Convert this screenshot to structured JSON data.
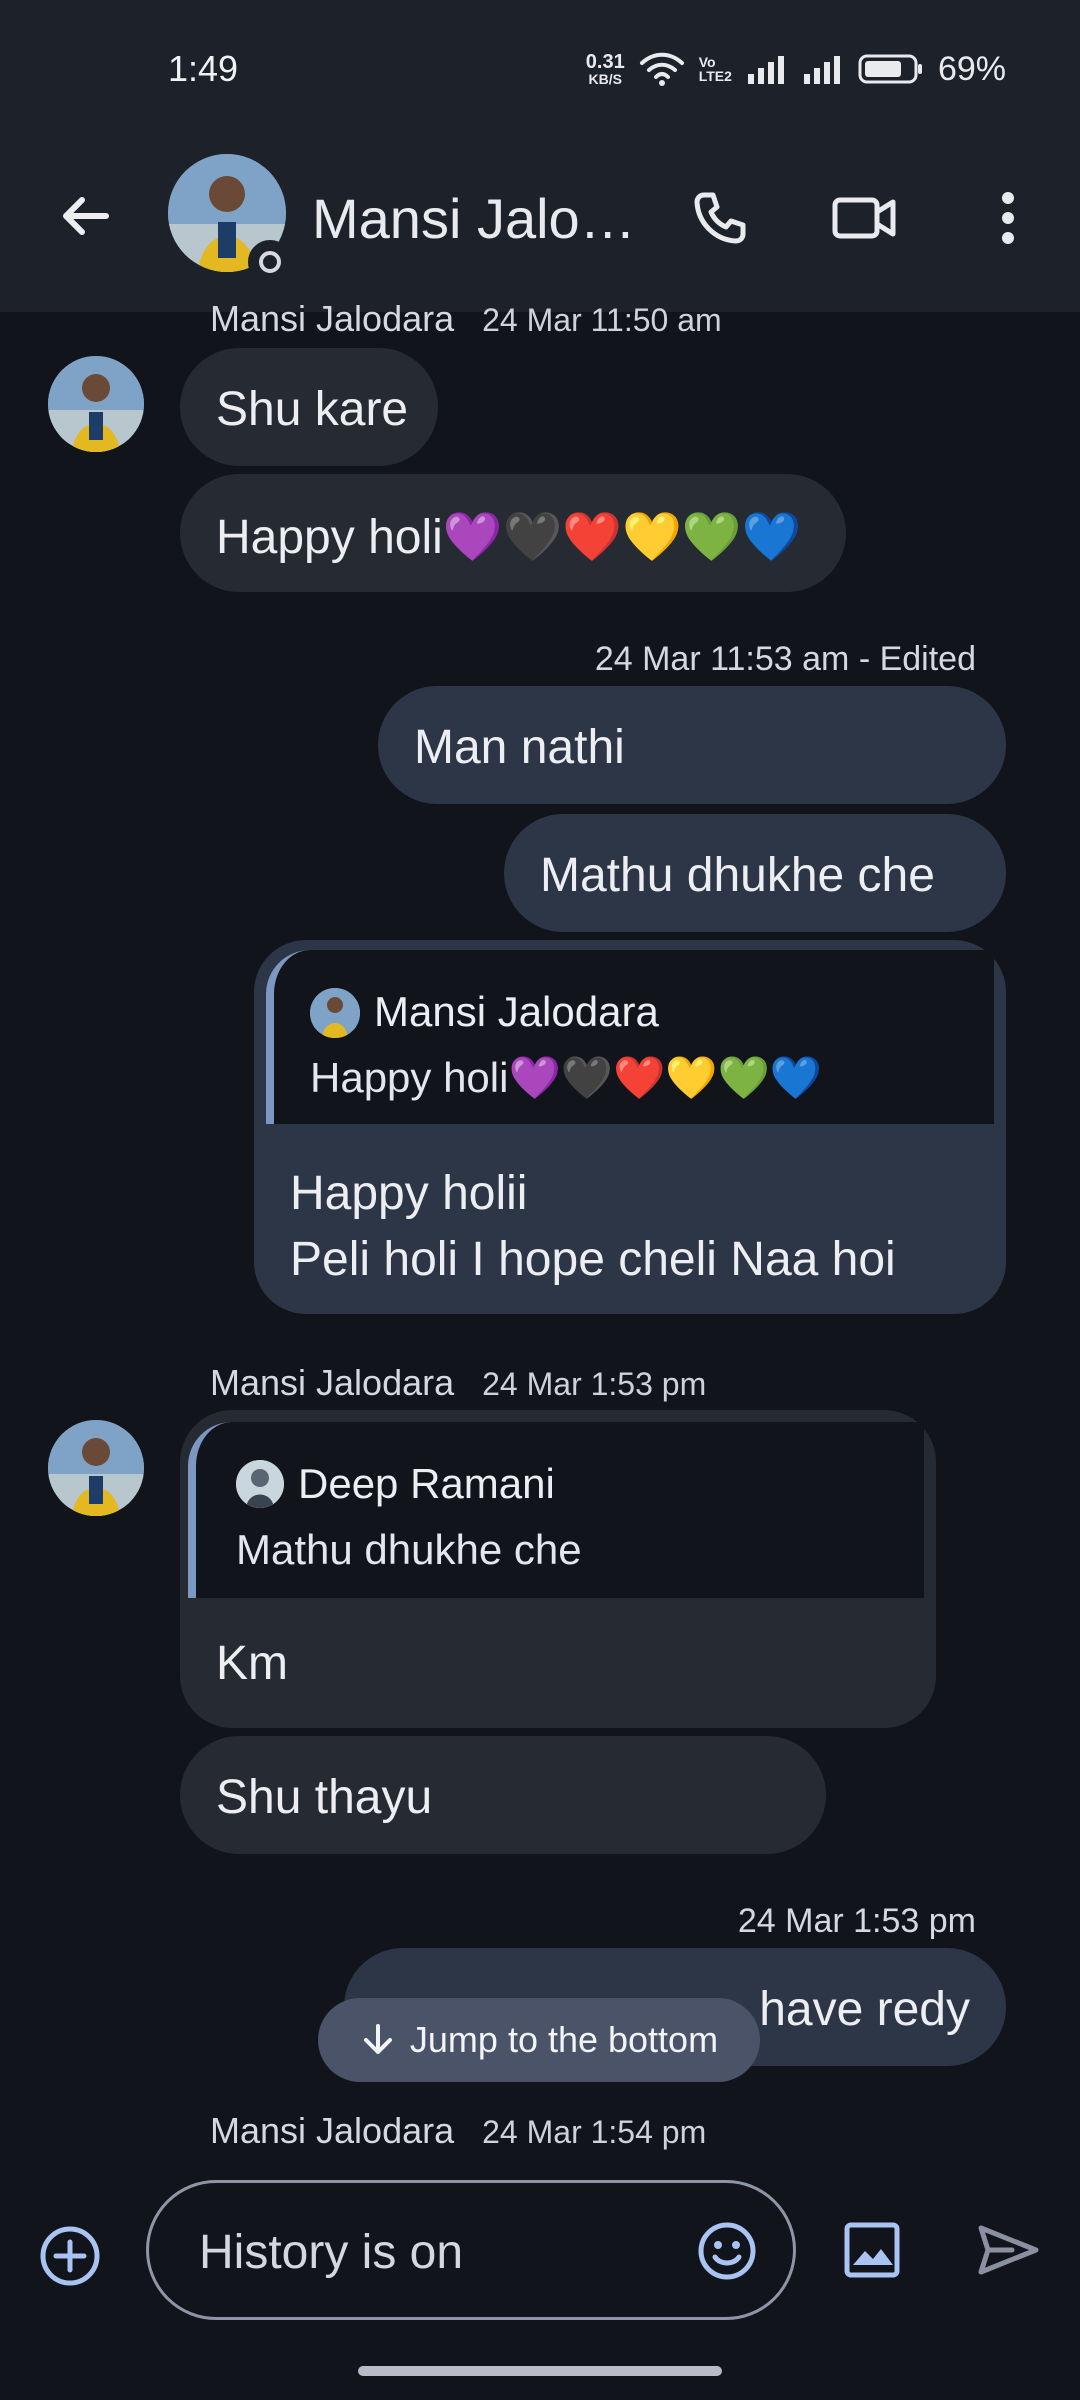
{
  "status_bar": {
    "time": "1:49",
    "network_speed_value": "0.31",
    "network_speed_unit": "KB/S",
    "volte_top": "Vo",
    "volte_bottom": "LTE2",
    "battery_percent": "69%"
  },
  "header": {
    "title": "Mansi Jalo…",
    "icons": [
      "back-arrow-icon",
      "phone-icon",
      "video-icon",
      "more-vert-icon"
    ]
  },
  "messages": {
    "m1_sender": "Mansi Jalodara",
    "m1_time": "24 Mar 11:50 am",
    "m1_text1": "Shu kare",
    "m1_text2": "Happy holi💜🖤❤️💛💚💙",
    "m2_meta_time": "24 Mar 11:53 am",
    "m2_meta_sep": "-",
    "m2_meta_status": "Edited",
    "m2_text1": "Man nathi",
    "m2_text2": "Mathu dhukhe che",
    "m3_reply_name": "Mansi Jalodara",
    "m3_reply_text": "Happy holi💜🖤❤️💛💚💙",
    "m3_line1": "Happy holii",
    "m3_line2": "Peli holi I hope cheli Naa hoi",
    "m4_sender": "Mansi Jalodara",
    "m4_time": "24 Mar 1:53 pm",
    "m4_reply_name": "Deep Ramani",
    "m4_reply_text": "Mathu dhukhe che",
    "m4_text1": "Km",
    "m4_text2": "Shu thayu",
    "m5_time": "24 Mar 1:53 pm",
    "m5_text": "have redy",
    "m6_sender": "Mansi Jalodara",
    "m6_time": "24 Mar 1:54 pm"
  },
  "jump": {
    "label": "Jump to the bottom"
  },
  "composer": {
    "placeholder": "History is on"
  },
  "colors": {
    "background": "#11141b",
    "header": "#1d2129",
    "incoming_bubble": "#262a32",
    "outgoing_bubble": "#2d3647",
    "accent": "#a9c4f2"
  }
}
